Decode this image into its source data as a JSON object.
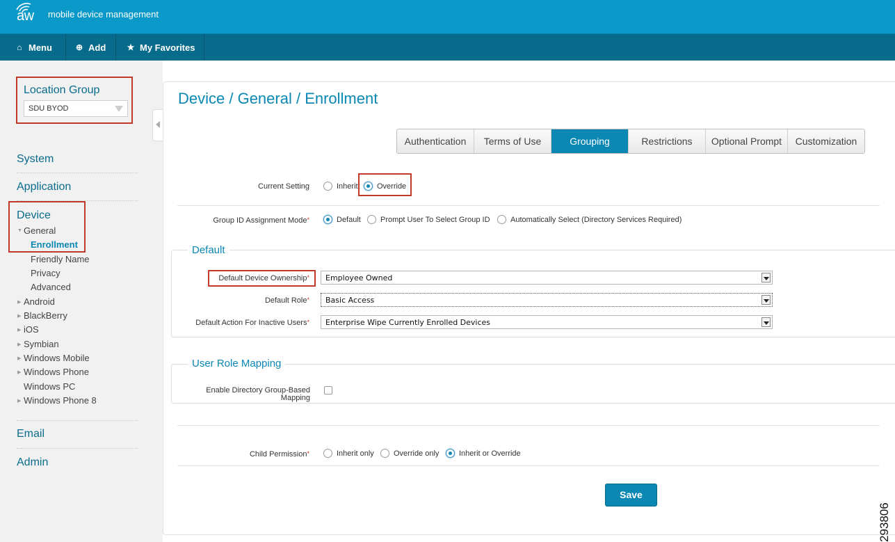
{
  "app": {
    "logo_text": "aw",
    "title": "mobile device management"
  },
  "nav": [
    {
      "label": "Menu",
      "icon": "home-icon"
    },
    {
      "label": "Add",
      "icon": "plus-circle-icon"
    },
    {
      "label": "My Favorites",
      "icon": "star-icon"
    }
  ],
  "location_group": {
    "title": "Location Group",
    "value": "SDU BYOD"
  },
  "sidebar": {
    "system": "System",
    "application": "Application",
    "device": "Device",
    "general": "General",
    "general_children": [
      "Enrollment",
      "Friendly Name",
      "Privacy",
      "Advanced"
    ],
    "platforms": [
      "Android",
      "BlackBerry",
      "iOS",
      "Symbian",
      "Windows Mobile",
      "Windows Phone",
      "Windows PC",
      "Windows Phone 8"
    ],
    "email": "Email",
    "admin": "Admin"
  },
  "page": {
    "title": "Device / General / Enrollment"
  },
  "tabs": [
    "Authentication",
    "Terms of Use",
    "Grouping",
    "Restrictions",
    "Optional Prompt",
    "Customization"
  ],
  "active_tab": "Grouping",
  "current_setting": {
    "label": "Current Setting",
    "options": [
      "Inherit",
      "Override"
    ],
    "selected": "Override"
  },
  "group_id_mode": {
    "label": "Group ID Assignment Mode",
    "required": "*",
    "options": [
      "Default",
      "Prompt User To Select Group ID",
      "Automatically Select (Directory Services Required)"
    ],
    "selected": "Default"
  },
  "default_section": {
    "title": "Default",
    "ownership": {
      "label": "Default Device Ownership",
      "required": "*",
      "value": "Employee Owned"
    },
    "role": {
      "label": "Default Role",
      "required": "*",
      "value": "Basic Access"
    },
    "inactive": {
      "label": "Default Action For Inactive Users",
      "required": "*",
      "value": "Enterprise Wipe Currently Enrolled Devices"
    }
  },
  "user_role_mapping": {
    "title": "User Role Mapping",
    "enable_label_1": "Enable Directory Group-Based",
    "enable_label_2": "Mapping",
    "enabled": false
  },
  "child_permission": {
    "label": "Child Permission",
    "required": "*",
    "options": [
      "Inherit only",
      "Override only",
      "Inherit or Override"
    ],
    "selected": "Inherit or Override"
  },
  "save_label": "Save",
  "figure_number": "293806",
  "colors": {
    "brand": "#0a99c8",
    "navbar": "#076b8b",
    "accent": "#0a87b3",
    "highlight": "#c0392b"
  }
}
